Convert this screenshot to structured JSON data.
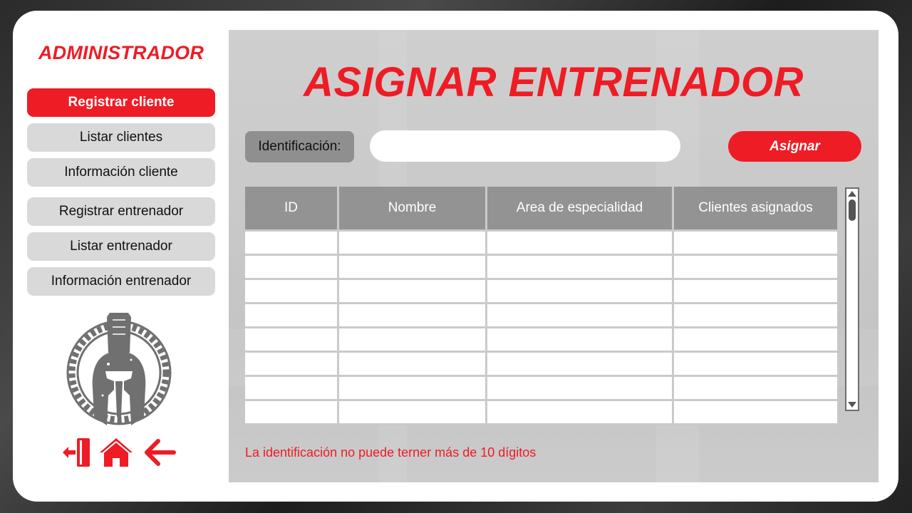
{
  "sidebar": {
    "title": "ADMINISTRADOR",
    "items": [
      {
        "label": "Registrar cliente",
        "active": true
      },
      {
        "label": "Listar clientes",
        "active": false
      },
      {
        "label": "Información cliente",
        "active": false
      },
      {
        "label": "Registrar entrenador",
        "active": false
      },
      {
        "label": "Listar entrenador",
        "active": false
      },
      {
        "label": "Información entrenador",
        "active": false
      }
    ],
    "logo": "spartan-helmet-logo",
    "bottom_icons": [
      "logout-door-icon",
      "home-icon",
      "back-arrow-icon"
    ]
  },
  "main": {
    "title": "ASIGNAR ENTRENADOR",
    "id_label": "Identificación:",
    "id_value": "",
    "assign_label": "Asignar",
    "table": {
      "headers": [
        "ID",
        "Nombre",
        "Area de especialidad",
        "Clientes asignados"
      ],
      "rows": [
        [
          "",
          "",
          "",
          ""
        ],
        [
          "",
          "",
          "",
          ""
        ],
        [
          "",
          "",
          "",
          ""
        ],
        [
          "",
          "",
          "",
          ""
        ],
        [
          "",
          "",
          "",
          ""
        ],
        [
          "",
          "",
          "",
          ""
        ],
        [
          "",
          "",
          "",
          ""
        ],
        [
          "",
          "",
          "",
          ""
        ]
      ]
    },
    "error_message": "La identificación no puede terner más de 10 dígitos"
  },
  "colors": {
    "accent": "#ee1c25",
    "button_gray": "#d9d9d9",
    "header_gray": "#939393",
    "logo_gray": "#707070"
  }
}
